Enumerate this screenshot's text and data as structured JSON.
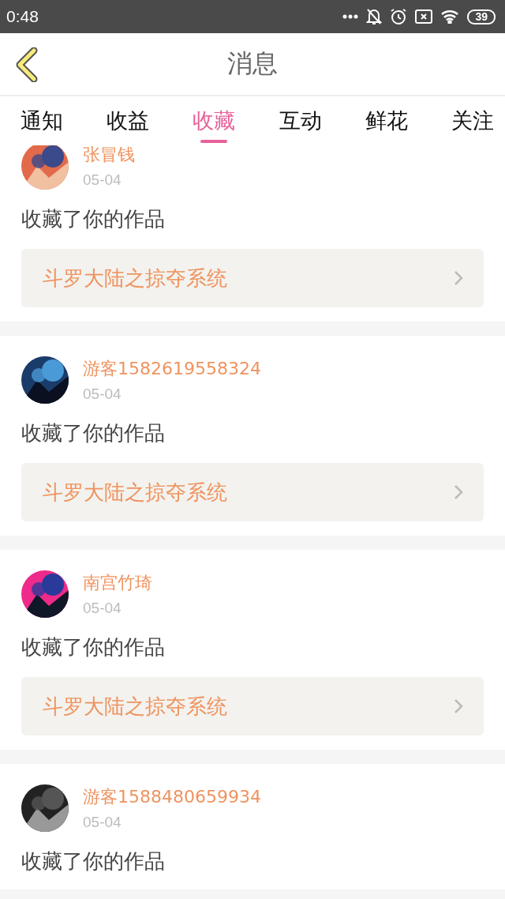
{
  "status_bar": {
    "time": "0:48",
    "battery": "39"
  },
  "header": {
    "title": "消息"
  },
  "tabs": [
    {
      "label": "通知",
      "selected": false
    },
    {
      "label": "收益",
      "selected": false
    },
    {
      "label": "收藏",
      "selected": true
    },
    {
      "label": "互动",
      "selected": false
    },
    {
      "label": "鲜花",
      "selected": false
    },
    {
      "label": "关注",
      "selected": false
    }
  ],
  "messages": [
    {
      "user": "张冒钱",
      "date": "05-04",
      "text": "收藏了你的作品",
      "work": "斗罗大陆之掠夺系统"
    },
    {
      "user": "游客1582619558324",
      "date": "05-04",
      "text": "收藏了你的作品",
      "work": "斗罗大陆之掠夺系统"
    },
    {
      "user": "南宫竹琦",
      "date": "05-04",
      "text": "收藏了你的作品",
      "work": "斗罗大陆之掠夺系统"
    },
    {
      "user": "游客1588480659934",
      "date": "05-04",
      "text": "收藏了你的作品"
    }
  ]
}
